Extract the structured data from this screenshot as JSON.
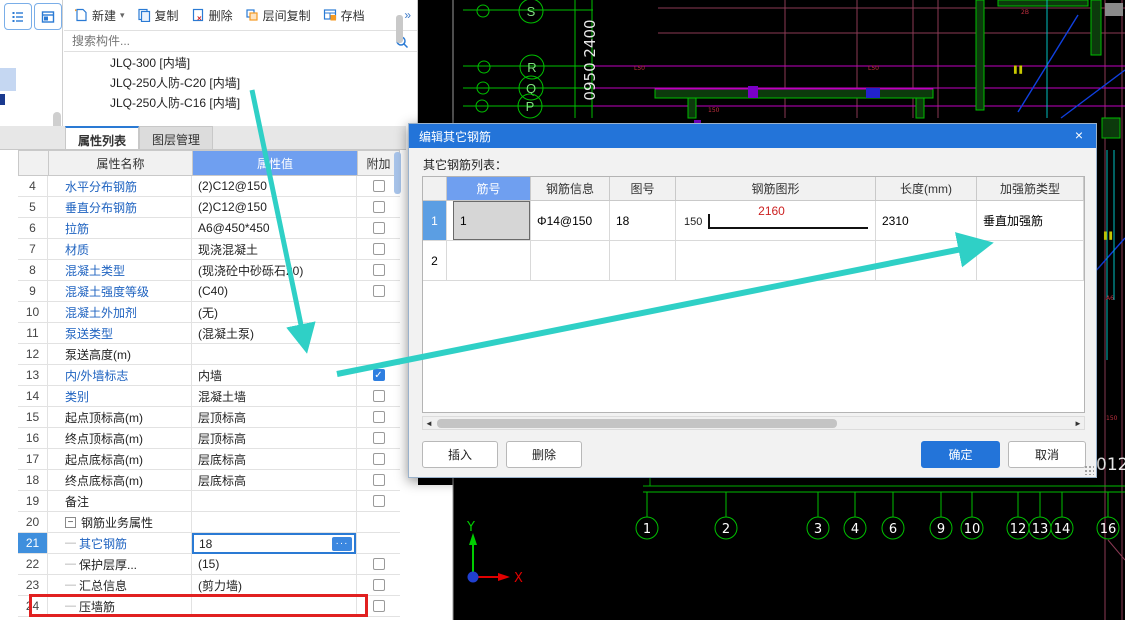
{
  "sidebar": {
    "icon1": "list-view-icon",
    "icon2": "panel-view-icon"
  },
  "toolbar": {
    "new_label": "新建",
    "copy_label": "复制",
    "delete_label": "删除",
    "layer_copy_label": "层间复制",
    "archive_label": "存档",
    "overflow": "»"
  },
  "search": {
    "placeholder": "搜索构件..."
  },
  "component_list": {
    "items": [
      "JLQ-300 [内墙]",
      "JLQ-250人防-C20 [内墙]",
      "JLQ-250人防-C16 [内墙]"
    ]
  },
  "tabs": {
    "properties": "属性列表",
    "layers": "图层管理"
  },
  "property_table": {
    "headers": {
      "name": "属性名称",
      "value": "属性值",
      "extra": "附加"
    },
    "rows": [
      {
        "num": "4",
        "name": "水平分布钢筋",
        "value": "(2)C12@150",
        "checkbox": "unchecked",
        "link": true
      },
      {
        "num": "5",
        "name": "垂直分布钢筋",
        "value": "(2)C12@150",
        "checkbox": "unchecked",
        "link": true
      },
      {
        "num": "6",
        "name": "拉筋",
        "value": "A6@450*450",
        "checkbox": "unchecked",
        "link": true
      },
      {
        "num": "7",
        "name": "材质",
        "value": "现浇混凝土",
        "checkbox": "unchecked",
        "link": true
      },
      {
        "num": "8",
        "name": "混凝土类型",
        "value": "(现浇砼中砂砾石20)",
        "checkbox": "unchecked",
        "link": true
      },
      {
        "num": "9",
        "name": "混凝土强度等级",
        "value": "(C40)",
        "checkbox": "unchecked",
        "link": true
      },
      {
        "num": "10",
        "name": "混凝土外加剂",
        "value": "(无)",
        "checkbox": "none",
        "link": true
      },
      {
        "num": "11",
        "name": "泵送类型",
        "value": "(混凝土泵)",
        "checkbox": "none",
        "link": true
      },
      {
        "num": "12",
        "name": "泵送高度(m)",
        "value": "",
        "checkbox": "none",
        "link": false
      },
      {
        "num": "13",
        "name": "内/外墙标志",
        "value": "内墙",
        "checkbox": "checked",
        "link": true
      },
      {
        "num": "14",
        "name": "类别",
        "value": "混凝土墙",
        "checkbox": "unchecked",
        "link": true
      },
      {
        "num": "15",
        "name": "起点顶标高(m)",
        "value": "层顶标高",
        "checkbox": "unchecked",
        "link": false
      },
      {
        "num": "16",
        "name": "终点顶标高(m)",
        "value": "层顶标高",
        "checkbox": "unchecked",
        "link": false
      },
      {
        "num": "17",
        "name": "起点底标高(m)",
        "value": "层底标高",
        "checkbox": "unchecked",
        "link": false
      },
      {
        "num": "18",
        "name": "终点底标高(m)",
        "value": "层底标高",
        "checkbox": "unchecked",
        "link": false
      },
      {
        "num": "19",
        "name": "备注",
        "value": "",
        "checkbox": "unchecked",
        "link": false
      },
      {
        "num": "20",
        "name": "钢筋业务属性",
        "value": "",
        "checkbox": "none",
        "link": false,
        "group": true
      },
      {
        "num": "21",
        "name": "其它钢筋",
        "value": "18",
        "checkbox": "none",
        "link": true,
        "indent": true,
        "selected": true,
        "editor": true
      },
      {
        "num": "22",
        "name": "保护层厚...",
        "value": "(15)",
        "checkbox": "unchecked",
        "link": false,
        "indent": true
      },
      {
        "num": "23",
        "name": "汇总信息",
        "value": "(剪力墙)",
        "checkbox": "unchecked",
        "link": false,
        "indent": true
      },
      {
        "num": "24",
        "name": "压墙筋",
        "value": "",
        "checkbox": "unchecked",
        "link": false,
        "indent": true,
        "highlight": true
      }
    ]
  },
  "dialog": {
    "title": "编辑其它钢筋",
    "close": "×",
    "list_label": "其它钢筋列表：",
    "table": {
      "headers": [
        "",
        "筋号",
        "钢筋信息",
        "图号",
        "钢筋图形",
        "长度(mm)",
        "加强筋类型"
      ],
      "rows": [
        {
          "num": "1",
          "bar_no": "1",
          "info": "Φ14@150",
          "fig_no": "18",
          "shape_left": "150",
          "shape_top": "2160",
          "length": "2310",
          "type": "垂直加强筋",
          "selected": true
        },
        {
          "num": "2",
          "bar_no": "",
          "info": "",
          "fig_no": "",
          "shape_left": "",
          "shape_top": "",
          "length": "",
          "type": "",
          "selected": false
        }
      ]
    },
    "buttons": {
      "insert": "插入",
      "delete": "删除",
      "ok": "确定",
      "cancel": "取消"
    }
  },
  "cad": {
    "axis_letters": [
      "S",
      "R",
      "Q",
      "P"
    ],
    "dim_text": "0950 2400",
    "bottom_bubbles": [
      "1",
      "2",
      "3",
      "4",
      "6",
      "9",
      "10",
      "12",
      "13",
      "14",
      "16"
    ],
    "partial_text": "012",
    "ucs": {
      "x_label": "X",
      "y_label": "Y"
    }
  },
  "colors": {
    "accent_blue": "#2374d9",
    "header_blue": "#6f9ff0",
    "link_blue": "#1f63c0",
    "annotation_teal": "#2fd0c6",
    "highlight_red": "#e12020",
    "cad_green": "#00bf00",
    "cad_magenta": "#c000c0",
    "cad_grid": "#8b3a55",
    "shape_dim_red": "#cc2222"
  }
}
